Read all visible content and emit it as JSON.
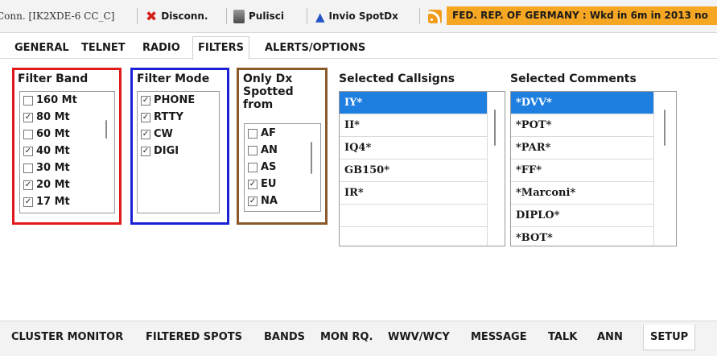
{
  "toolbar": {
    "connection": "Conn. [IK2XDE-6 CC_C]",
    "disconnect_label": "Disconn.",
    "clean_label": "Pulisci",
    "send_spot_label": "Invio SpotDx",
    "banner_text": "FED. REP. OF GERMANY : Wkd in 6m in 2013 no",
    "icons": {
      "disconnect": "x-icon",
      "clean": "trash-icon",
      "send_spot": "a-icon",
      "feed": "rss-icon"
    }
  },
  "top_tabs": [
    "GENERAL",
    "TELNET",
    "RADIO",
    "FILTERS",
    "ALERTS/OPTIONS"
  ],
  "active_top_tab": "FILTERS",
  "filter_band": {
    "title": "Filter Band",
    "items": [
      {
        "label": "160 Mt",
        "checked": false
      },
      {
        "label": "80 Mt",
        "checked": true
      },
      {
        "label": "60 Mt",
        "checked": false
      },
      {
        "label": "40 Mt",
        "checked": true
      },
      {
        "label": "30 Mt",
        "checked": false
      },
      {
        "label": "20 Mt",
        "checked": true
      },
      {
        "label": "17 Mt",
        "checked": true
      }
    ]
  },
  "filter_mode": {
    "title": "Filter Mode",
    "items": [
      {
        "label": "PHONE",
        "checked": true
      },
      {
        "label": "RTTY",
        "checked": true
      },
      {
        "label": "CW",
        "checked": true
      },
      {
        "label": "DIGI",
        "checked": true
      }
    ]
  },
  "only_dx": {
    "title_lines": [
      "Only Dx",
      "Spotted",
      "from"
    ],
    "items": [
      {
        "label": "AF",
        "checked": false
      },
      {
        "label": "AN",
        "checked": false
      },
      {
        "label": "AS",
        "checked": false
      },
      {
        "label": "EU",
        "checked": true
      },
      {
        "label": "NA",
        "checked": true
      }
    ]
  },
  "selected_callsigns": {
    "title": "Selected Callsigns",
    "items": [
      "IY*",
      "II*",
      "IQ4*",
      "GB150*",
      "IR*",
      "",
      ""
    ],
    "selected_index": 0
  },
  "selected_comments": {
    "title": "Selected Comments",
    "items": [
      "*DVV*",
      "*POT*",
      "*PAR*",
      "*FF*",
      "*Marconi*",
      "DIPLO*",
      "*BOT*"
    ],
    "selected_index": 0
  },
  "bottom_tabs": [
    "CLUSTER MONITOR",
    "FILTERED SPOTS",
    "BANDS",
    "MON RQ.",
    "WWV/WCY",
    "MESSAGE",
    "TALK",
    "ANN",
    "SETUP"
  ],
  "active_bottom_tab": "SETUP",
  "colors": {
    "band_frame": "#e0191a",
    "mode_frame": "#1a22d4",
    "dx_frame": "#8a5a2b",
    "selection": "#1e7fe0",
    "banner": "#f5a623"
  }
}
